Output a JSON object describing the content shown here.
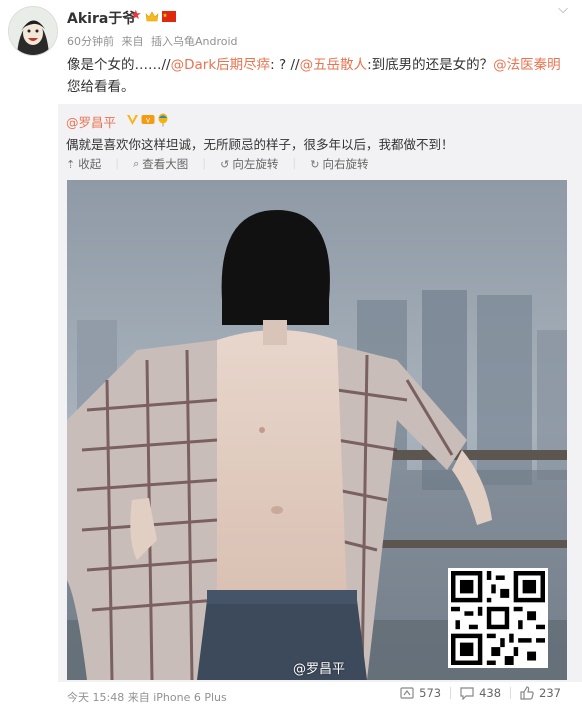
{
  "post": {
    "username": "Akira于爷",
    "badges": [
      "red-star-badge",
      "gold-crown-badge",
      "china-flag-badge"
    ],
    "time": "60分钟前",
    "source_prefix": "来自",
    "source": "插入乌龟Android",
    "text": {
      "prefix": "像是个女的……//",
      "mention1": "@Dark后期尽瘁",
      "mid1": ": ? //",
      "mention2": "@五岳散人",
      "mid2": ":到底男的还是女的？",
      "mention3": "@法医秦明",
      "suffix": " 您给看看。"
    }
  },
  "repost": {
    "author": "@罗昌平",
    "badges": [
      "verified-v-badge",
      "vip-badge",
      "balloon-badge"
    ],
    "text": "偶就是喜欢你这样坦诚，无所顾忌的样子，很多年以后，我都做不到！",
    "tools": {
      "collapse": "收起",
      "view_large": "查看大图",
      "rotate_left": "向左旋转",
      "rotate_right": "向右旋转"
    },
    "watermark": "@罗昌平"
  },
  "footer": {
    "time": "今天 15:48",
    "source_prefix": "来自",
    "device": "iPhone 6 Plus",
    "repost_count": "573",
    "comment_count": "438",
    "like_count": "237"
  },
  "colors": {
    "mention": "#eb7350",
    "repost_bg": "#f2f2f5",
    "meta_gray": "#919191"
  }
}
